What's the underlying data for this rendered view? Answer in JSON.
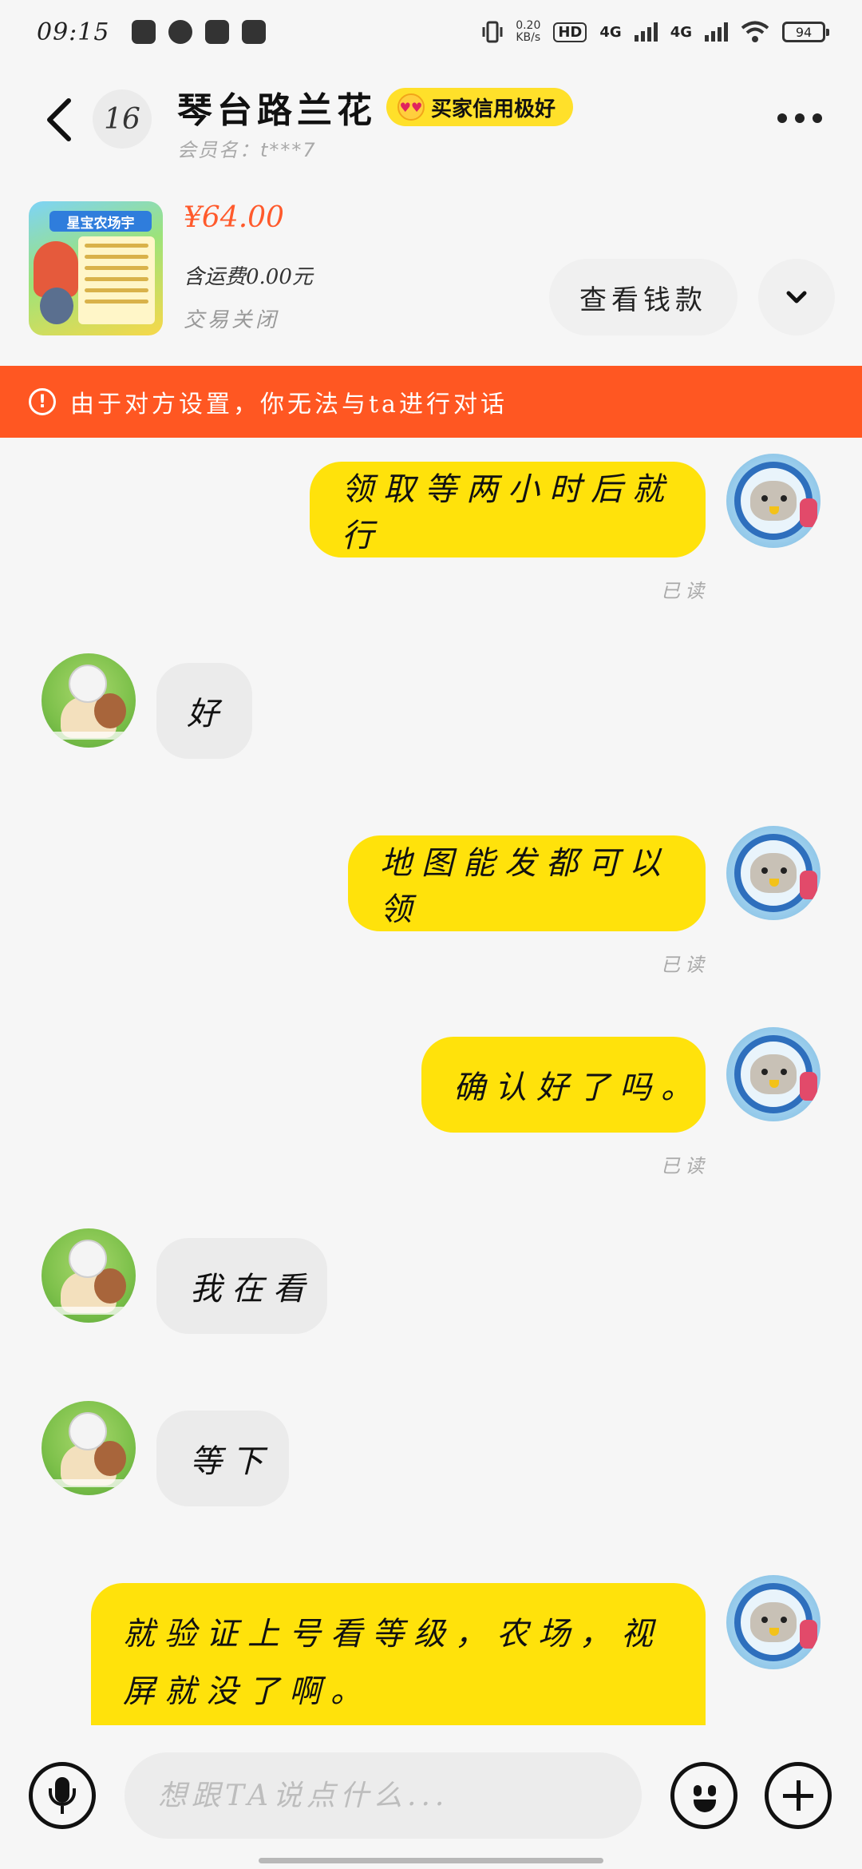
{
  "status_bar": {
    "time": "09:15",
    "net_speed_value": "0.20",
    "net_speed_unit": "KB/s",
    "hd_label": "HD",
    "signal1": "4G",
    "signal2": "4G",
    "battery": "94",
    "app_icons": [
      "douyin-icon",
      "wechat-icon",
      "book-icon",
      "dewu-icon"
    ]
  },
  "header": {
    "unread_count": "16",
    "peer_name": "琴台路兰花",
    "credit_badge": "买家信用极好",
    "member_name": "会员名：t***7"
  },
  "product": {
    "thumb_banner": "星宝农场宇",
    "price": "¥64.00",
    "shipping": "含运费0.00元",
    "status": "交易关闭",
    "view_button": "查看钱款"
  },
  "warning": {
    "text": "由于对方设置，你无法与ta进行对话"
  },
  "messages": [
    {
      "side": "mine",
      "text": "领取等两小时后就行",
      "read": "已读"
    },
    {
      "side": "theirs",
      "text": "好"
    },
    {
      "side": "mine",
      "text": "地图能发都可以领",
      "read": "已读"
    },
    {
      "side": "mine",
      "text": "确认好了吗。",
      "read": "已读"
    },
    {
      "side": "theirs",
      "text": "我在看"
    },
    {
      "side": "theirs",
      "text": "等下"
    },
    {
      "side": "mine",
      "text": "就验证上号看等级，农场，视屏就没了啊。"
    }
  ],
  "input": {
    "placeholder": "想跟TA说点什么..."
  },
  "colors": {
    "accent_yellow": "#ffe20b",
    "warning_orange": "#ff5722",
    "price_red": "#ff5a2c"
  }
}
